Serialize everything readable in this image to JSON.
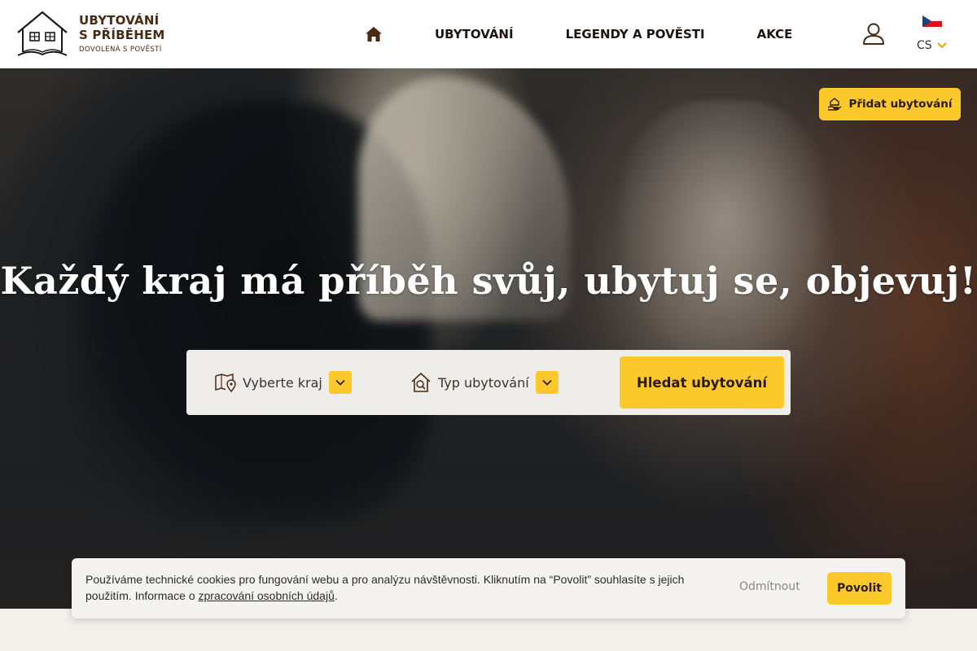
{
  "header": {
    "logo": {
      "line1": "UBYTOVÁNÍ",
      "line2": "S PŘÍBĚHEM",
      "line3": "DOVOLENÁ S POVĚSTÍ"
    },
    "nav": [
      {
        "label": "UBYTOVÁNÍ"
      },
      {
        "label": "LEGENDY A POVĚSTI"
      },
      {
        "label": "AKCE"
      }
    ],
    "home_icon": "home-icon",
    "user_icon": "user-icon",
    "language": {
      "code": "CS",
      "flag": "czech-flag-icon"
    }
  },
  "hero": {
    "add_button_label": "Přidat ubytování",
    "title": "Každý kraj má příběh svůj, ubytuj se, objevuj!",
    "search": {
      "region_label": "Vyberte kraj",
      "type_label": "Typ ubytování",
      "button_label": "Hledat ubytování"
    }
  },
  "cookie": {
    "text_part1": "Používáme technické cookies pro fungování webu a pro analýzu návštěvnosti. Kliknutím na “Povolit” souhlasíte s jejich použitím. Informace o ",
    "link_text": "zpracování osobních údajů",
    "text_end": ".",
    "reject_label": "Odmítnout",
    "accept_label": "Povolit"
  },
  "colors": {
    "accent": "#fbc92b",
    "brand_brown": "#4a2a12",
    "nav_text": "#1b1410"
  }
}
